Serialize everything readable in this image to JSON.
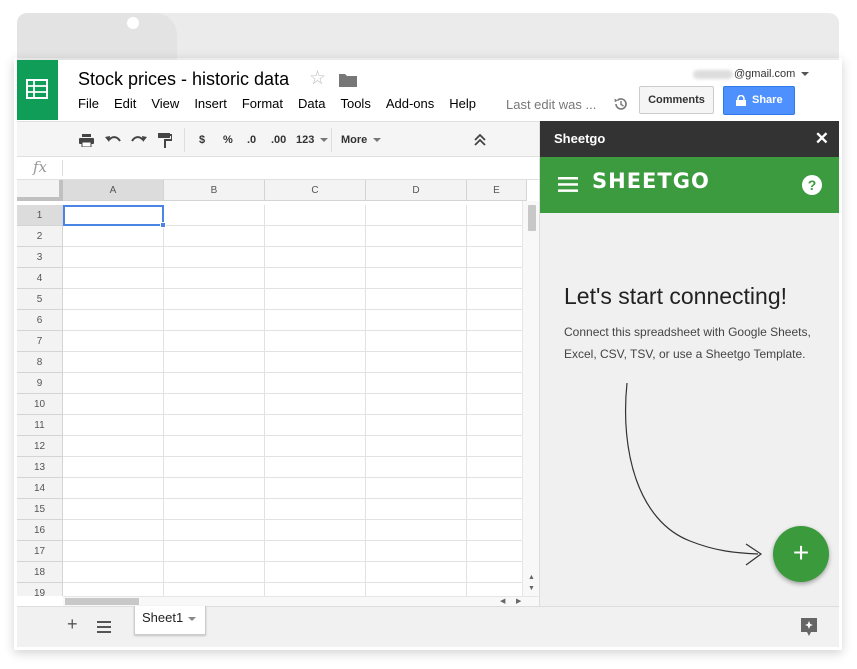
{
  "document": {
    "title": "Stock prices - historic data",
    "last_edit": "Last edit was ..."
  },
  "account": {
    "email_suffix": "@gmail.com"
  },
  "menu": [
    "File",
    "Edit",
    "View",
    "Insert",
    "Format",
    "Data",
    "Tools",
    "Add-ons",
    "Help"
  ],
  "buttons": {
    "comments": "Comments",
    "share": "Share"
  },
  "toolbar": {
    "currency": "$",
    "percent": "%",
    "decrease_decimal": ".0",
    "increase_decimal": ".00",
    "number_format": "123",
    "more": "More"
  },
  "formula": {
    "fx": "fx"
  },
  "grid": {
    "columns": [
      "A",
      "B",
      "C",
      "D",
      "E"
    ],
    "rows": [
      "1",
      "2",
      "3",
      "4",
      "5",
      "6",
      "7",
      "8",
      "9",
      "10",
      "11",
      "12",
      "13",
      "14",
      "15",
      "16",
      "17",
      "18",
      "19"
    ]
  },
  "sheets": [
    {
      "name": "Sheet1"
    }
  ],
  "panel": {
    "header": "Sheetgo",
    "brand": "SHEETGO",
    "headline": "Let's start connecting!",
    "description": "Connect this spreadsheet with Google Sheets, Excel, CSV, TSV, or use a Sheetgo Template.",
    "fab": "+"
  },
  "colors": {
    "sheets_green": "#0f9d58",
    "sheetgo_green": "#3c9a3f",
    "share_blue": "#4d90fe",
    "panel_header": "#333333"
  }
}
